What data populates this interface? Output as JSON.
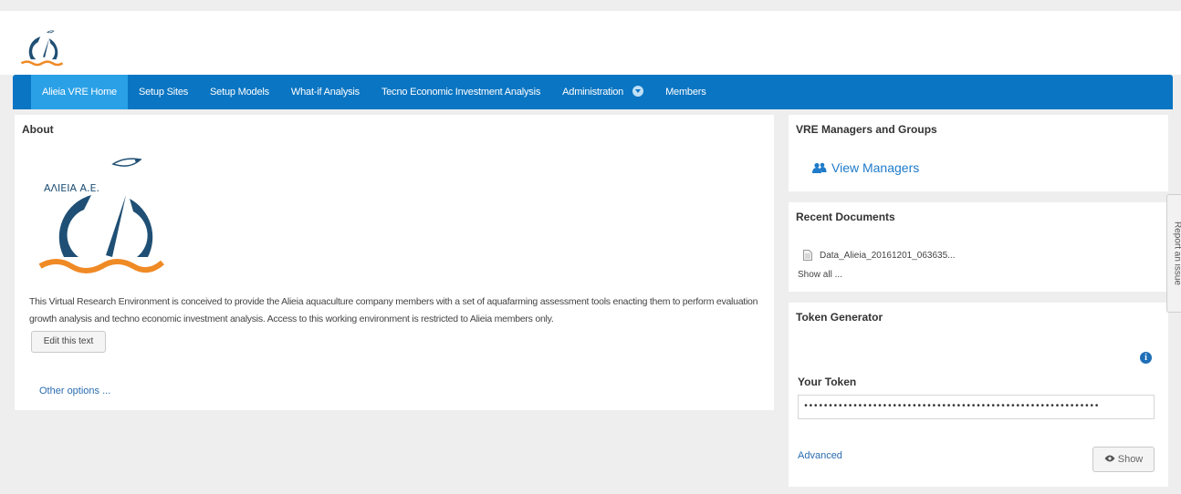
{
  "nav": {
    "items": [
      {
        "label": "Alieia VRE Home",
        "active": true
      },
      {
        "label": "Setup Sites"
      },
      {
        "label": "Setup Models"
      },
      {
        "label": "What-if Analysis"
      },
      {
        "label": "Tecno Economic Investment Analysis"
      },
      {
        "label": "Administration",
        "has_dropdown": true
      },
      {
        "label": "Members"
      }
    ]
  },
  "about": {
    "title": "About",
    "logo_text": "ΑΛΙΕΙΑ Α.Ε.",
    "description": "This Virtual Research Environment is conceived to provide the Alieia aquaculture company members with a set of aquafarming assessment tools enacting them to perform evaluation growth analysis and techno economic investment analysis. Access to this working environment is restricted to Alieia members only.",
    "edit_button": "Edit this text",
    "other_options": "Other options ..."
  },
  "vre_managers": {
    "title": "VRE Managers and Groups",
    "link": "View Managers"
  },
  "recent_documents": {
    "title": "Recent Documents",
    "document": "Data_Alieia_20161201_063635...",
    "show_all": "Show all ..."
  },
  "token_generator": {
    "title": "Token Generator",
    "your_token_label": "Your Token",
    "token_value": "••••••••••••••••••••••••••••••••••••••••••••••••••••••••••••",
    "advanced": "Advanced",
    "show_button": "Show"
  },
  "report_issue": "Report an issue",
  "colors": {
    "navbar": "#0a75c2",
    "nav_active": "#2aa0e6",
    "logo_blue": "#1f4f74",
    "logo_orange": "#ef8a25",
    "link": "#2a6db0"
  }
}
